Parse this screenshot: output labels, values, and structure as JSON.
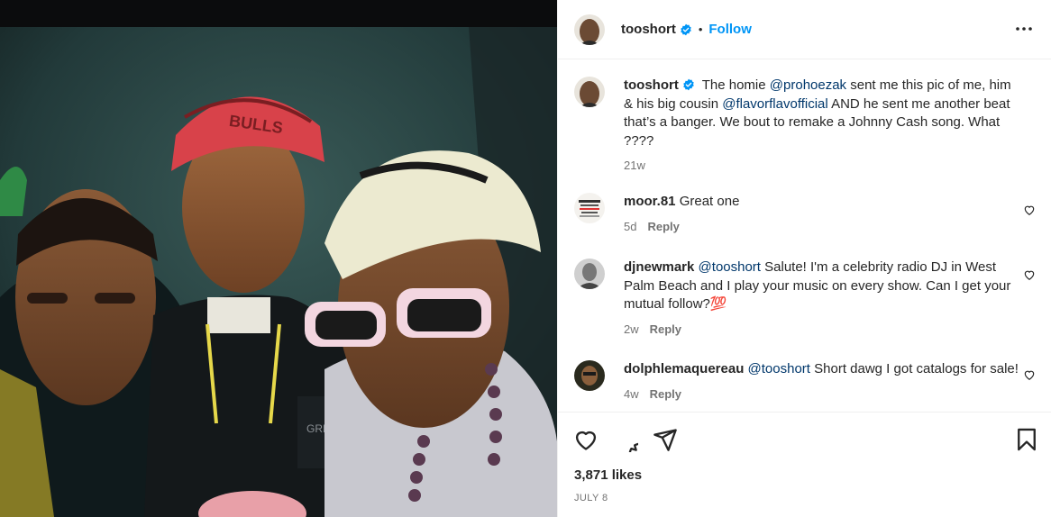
{
  "post": {
    "username": "tooshort",
    "follow_label": "Follow",
    "caption": {
      "username": "tooshort",
      "parts": [
        {
          "text": "The homie "
        },
        {
          "text": "@prohoezak",
          "mention": true
        },
        {
          "text": " sent me this pic of me, him & his big cousin "
        },
        {
          "text": "@flavorflavofficial",
          "mention": true
        },
        {
          "text": " AND he sent me another beat that’s a banger. We bout to remake a Johnny Cash song. What ????"
        }
      ],
      "age": "21w"
    },
    "likes": "3,871 likes",
    "date": "JULY 8"
  },
  "comments": [
    {
      "username": "moor.81",
      "parts": [
        {
          "text": "Great one"
        }
      ],
      "age": "5d",
      "reply_label": "Reply"
    },
    {
      "username": "djnewmark",
      "parts": [
        {
          "text": "@tooshort",
          "mention": true
        },
        {
          "text": " Salute! I'm a celebrity radio DJ in West Palm Beach and I play your music on every show. Can I get your mutual follow?💯"
        }
      ],
      "age": "2w",
      "reply_label": "Reply"
    },
    {
      "username": "dolphlemaquereau",
      "parts": [
        {
          "text": "@tooshort",
          "mention": true
        },
        {
          "text": " Short dawg I got catalogs for sale!"
        }
      ],
      "age": "4w",
      "reply_label": "Reply"
    }
  ],
  "icons": {
    "like": "heart-icon",
    "comment": "comment-icon",
    "share": "paper-plane-icon",
    "save": "bookmark-icon",
    "more": "more-options-icon",
    "verified": "verified-badge-icon"
  },
  "colors": {
    "link": "#0095f6",
    "mention": "#00376b",
    "secondary_text": "#737373",
    "divider": "#efefef",
    "verified_badge": "#0095f6"
  }
}
